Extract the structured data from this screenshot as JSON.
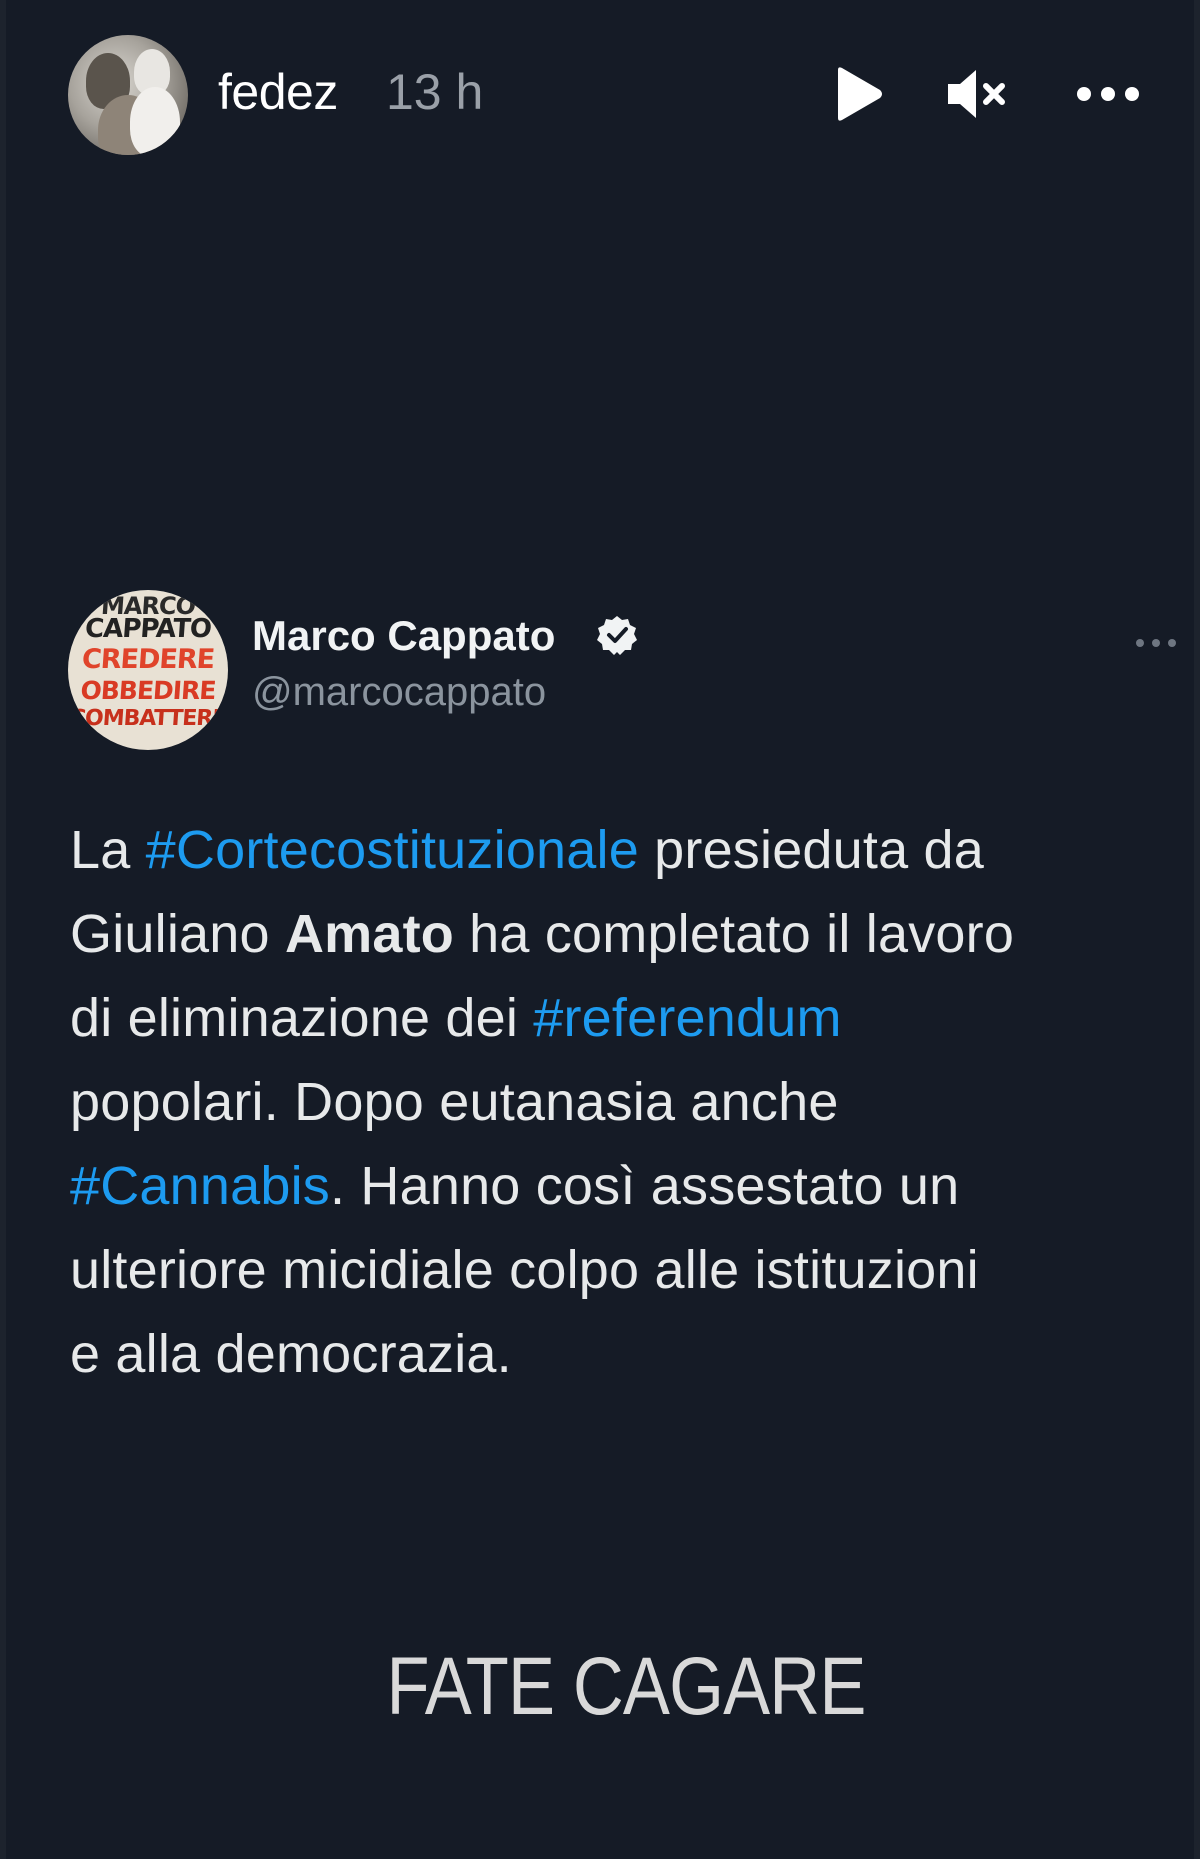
{
  "story": {
    "username": "fedez",
    "time": "13 h",
    "controls": {
      "play_icon": "play-icon",
      "mute_icon": "volume-muted-icon",
      "more_icon": "more-horizontal-icon"
    }
  },
  "tweet": {
    "name": "Marco Cappato",
    "verified": true,
    "handle": "@marcocappato",
    "avatar_text": [
      "MARCO",
      "CAPPATO",
      "CREDERE",
      "OBBEDIRE",
      "COMBATTERE"
    ],
    "text_lines": [
      [
        {
          "t": "La ",
          "k": "text"
        },
        {
          "t": "#Cortecostituzionale",
          "k": "hashtag"
        },
        {
          "t": " presieduta da",
          "k": "text"
        }
      ],
      [
        {
          "t": "Giuliano ",
          "k": "text"
        },
        {
          "t": "Amato",
          "k": "bold"
        },
        {
          "t": " ha completato il lavoro",
          "k": "text"
        }
      ],
      [
        {
          "t": "di eliminazione dei ",
          "k": "text"
        },
        {
          "t": "#referendum",
          "k": "hashtag"
        }
      ],
      [
        {
          "t": "popolari. Dopo eutanasia anche",
          "k": "text"
        }
      ],
      [
        {
          "t": "#Cannabis",
          "k": "hashtag"
        },
        {
          "t": ". Hanno così assestato un",
          "k": "text"
        }
      ],
      [
        {
          "t": "ulteriore micidiale colpo alle istituzioni",
          "k": "text"
        }
      ],
      [
        {
          "t": "e alla democrazia.",
          "k": "text"
        }
      ]
    ]
  },
  "caption": "FATE CAGARE",
  "colors": {
    "background": "#151b26",
    "hashtag": "#1d9bf0",
    "text": "#e7e9ea",
    "muted": "#8b949e"
  }
}
